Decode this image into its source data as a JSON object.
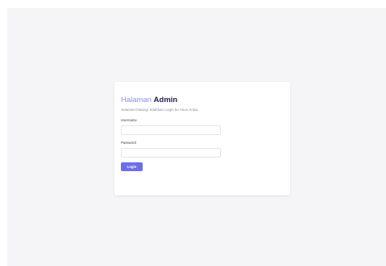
{
  "login": {
    "title_light": "Halaman",
    "title_bold": "Admin",
    "subtitle": "Selamat Datang! Silahkan Login ke Akun Anda.",
    "username_label": "Username",
    "username_value": "",
    "password_label": "Password",
    "password_value": "",
    "login_button": "Login"
  },
  "colors": {
    "page_bg": "#f5f5f7",
    "card_bg": "#ffffff",
    "accent": "#6c6ee8",
    "title_light": "#8b8ff0",
    "title_bold": "#1f1f4a"
  }
}
